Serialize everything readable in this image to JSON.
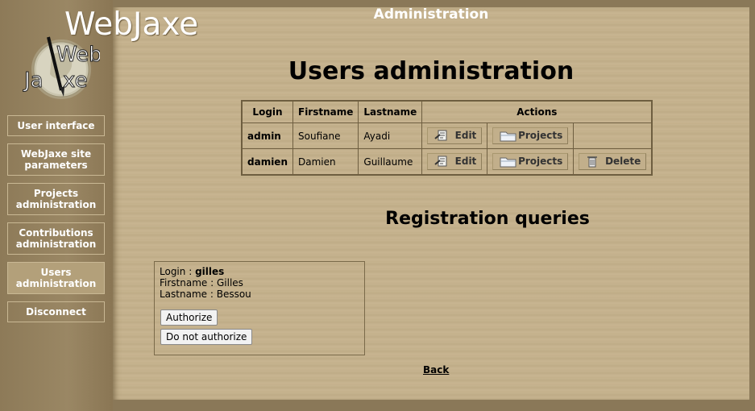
{
  "site": {
    "name": "WebJaxe"
  },
  "sidebar": {
    "items": [
      {
        "label": "User interface"
      },
      {
        "label": "WebJaxe site parameters"
      },
      {
        "label": "Projects administration"
      },
      {
        "label": "Contributions administration"
      },
      {
        "label": "Users administration",
        "active": true
      },
      {
        "label": "Disconnect"
      }
    ]
  },
  "header": {
    "title": "Administration"
  },
  "users_section": {
    "title": "Users administration",
    "columns": [
      "Login",
      "Firstname",
      "Lastname",
      "Actions"
    ],
    "rows": [
      {
        "login": "admin",
        "firstname": "Soufiane",
        "lastname": "Ayadi",
        "actions": [
          "Edit",
          "Projects"
        ]
      },
      {
        "login": "damien",
        "firstname": "Damien",
        "lastname": "Guillaume",
        "actions": [
          "Edit",
          "Projects",
          "Delete"
        ]
      }
    ]
  },
  "registration": {
    "title": "Registration queries",
    "query": {
      "login_label": "Login :",
      "login": "gilles",
      "firstname_label": "Firstname :",
      "firstname": "Gilles",
      "lastname_label": "Lastname :",
      "lastname": "Bessou",
      "authorize_label": "Authorize",
      "deny_label": "Do not authorize"
    }
  },
  "back_label": "Back",
  "colors": {
    "background": "#c3b08b",
    "sidebar": "#9a8764",
    "accent_white": "#ffffff"
  },
  "icons": {
    "edit": "edit-document-icon",
    "projects": "folder-icon",
    "delete": "trash-icon"
  }
}
